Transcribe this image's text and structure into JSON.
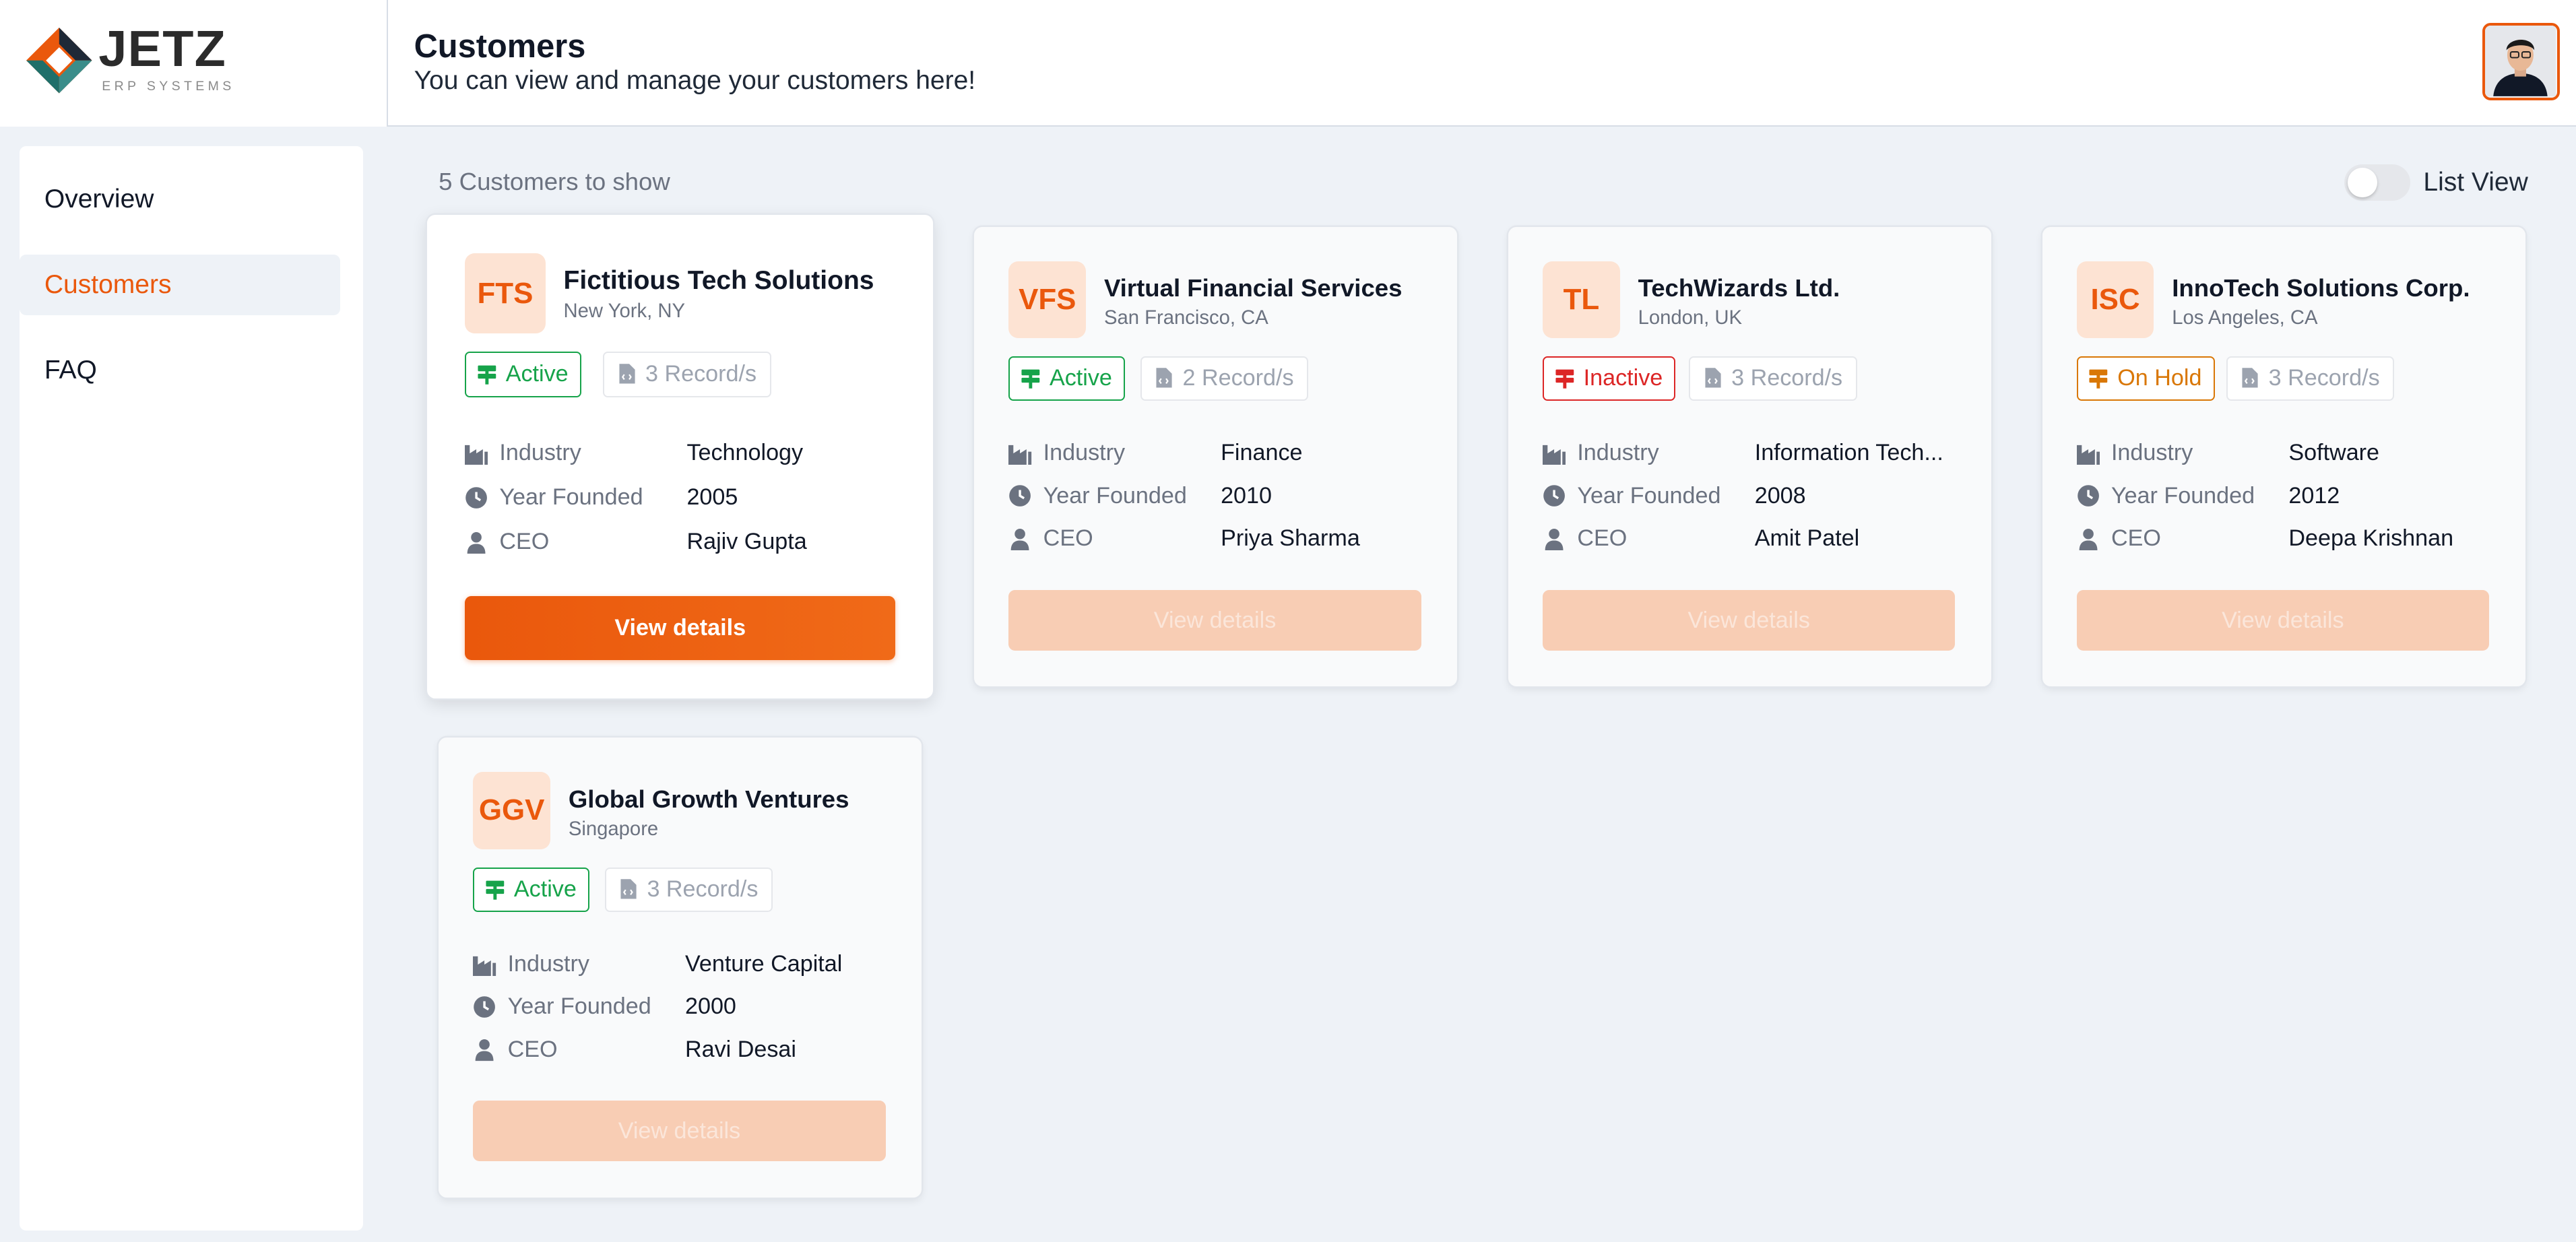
{
  "app": {
    "logo_text": "JETZ",
    "logo_subtext": "ERP SYSTEMS"
  },
  "header": {
    "title": "Customers",
    "subtitle": "You can view and manage your customers here!"
  },
  "sidebar": {
    "items": [
      {
        "label": "Overview",
        "active": false
      },
      {
        "label": "Customers",
        "active": true
      },
      {
        "label": "FAQ",
        "active": false
      }
    ]
  },
  "toolbar": {
    "count_label": "5 Customers to show",
    "toggle_label": "List View",
    "list_view_on": false
  },
  "field_labels": {
    "industry": "Industry",
    "year_founded": "Year Founded",
    "ceo": "CEO"
  },
  "customers": [
    {
      "initials": "FTS",
      "name": "Fictitious Tech Solutions",
      "location": "New York, NY",
      "status": "Active",
      "records": "3 Record/s",
      "industry": "Technology",
      "year_founded": "2005",
      "ceo": "Rajiv Gupta",
      "button": "View details"
    },
    {
      "initials": "VFS",
      "name": "Virtual Financial Services",
      "location": "San Francisco, CA",
      "status": "Active",
      "records": "2 Record/s",
      "industry": "Finance",
      "year_founded": "2010",
      "ceo": "Priya Sharma",
      "button": "View details"
    },
    {
      "initials": "TL",
      "name": "TechWizards Ltd.",
      "location": "London, UK",
      "status": "Inactive",
      "records": "3 Record/s",
      "industry": "Information Tech...",
      "year_founded": "2008",
      "ceo": "Amit Patel",
      "button": "View details"
    },
    {
      "initials": "ISC",
      "name": "InnoTech Solutions Corp.",
      "location": "Los Angeles, CA",
      "status": "On Hold",
      "records": "3 Record/s",
      "industry": "Software",
      "year_founded": "2012",
      "ceo": "Deepa Krishnan",
      "button": "View details"
    },
    {
      "initials": "GGV",
      "name": "Global Growth Ventures",
      "location": "Singapore",
      "status": "Active",
      "records": "3 Record/s",
      "industry": "Venture Capital",
      "year_founded": "2000",
      "ceo": "Ravi Desai",
      "button": "View details"
    }
  ],
  "colors": {
    "accent": "#ea580c",
    "accent_light": "#fde3d3",
    "status_active": "#16a34a",
    "status_inactive": "#dc2626",
    "status_onhold": "#d97706",
    "background": "#eef2f7"
  },
  "icons": {
    "logo": "diamond-logo-icon",
    "status": "signpost-icon",
    "records": "file-code-icon",
    "industry": "factory-icon",
    "year_founded": "clock-icon",
    "ceo": "user-icon"
  }
}
